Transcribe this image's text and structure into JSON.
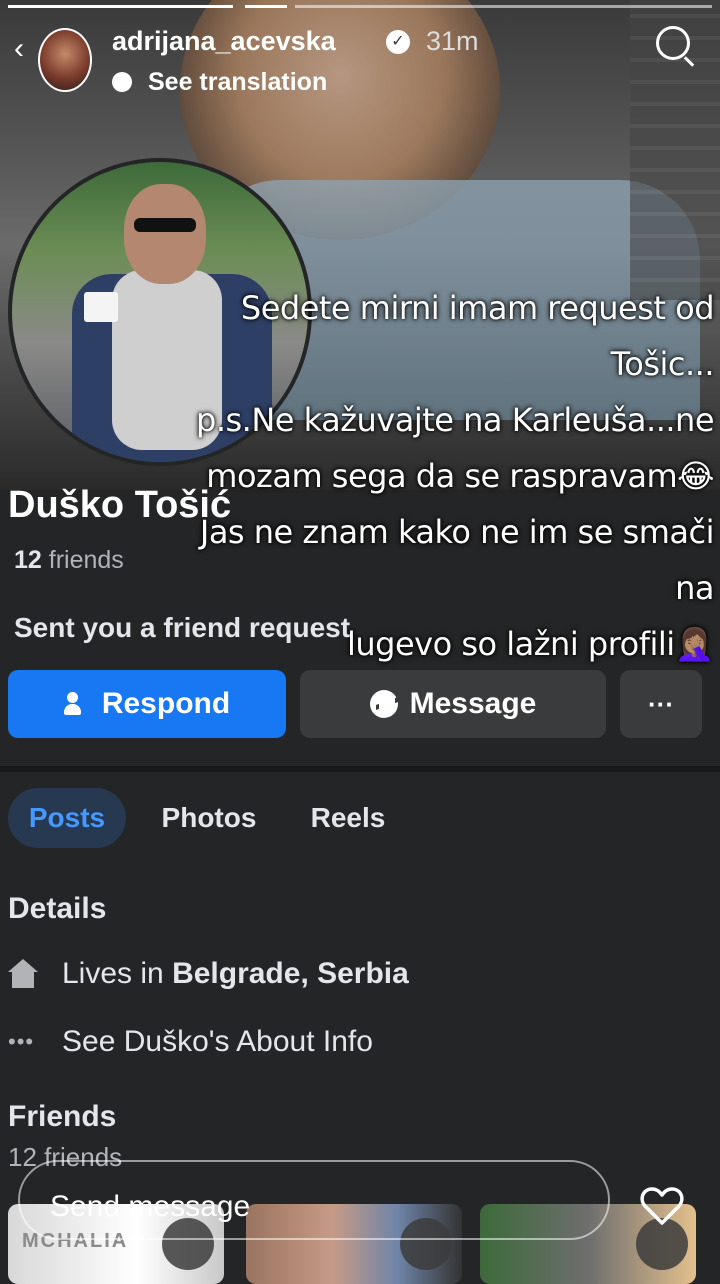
{
  "story": {
    "username": "adrijana_acevska",
    "time": "31m",
    "translation_label": "See translation",
    "caption_lines": [
      "Sedete mirni imam request od Tošic...",
      "p.s.Ne kažuvajte na Karleuša...ne",
      "mozam sega da se raspravam😂",
      "Jas ne znam kako ne im se smači na",
      "lugevo so lažni profili🤦🏽‍♀️"
    ],
    "send_placeholder": "Send message"
  },
  "profile": {
    "name": "Duško Tošić",
    "friends_count": "12",
    "friends_label": "friends",
    "request_text": "Sent you a friend request",
    "respond_label": "Respond",
    "message_label": "Message",
    "more_label": "···"
  },
  "tabs": [
    "Posts",
    "Photos",
    "Reels"
  ],
  "details": {
    "title": "Details",
    "lives_prefix": "Lives in",
    "lives_place": "Belgrade, Serbia",
    "about_label": "See Duško's About Info"
  },
  "friends": {
    "title": "Friends",
    "subtitle": "12 friends",
    "thumb1_text": "MCHALIA"
  },
  "colors": {
    "background": "#242526",
    "primary": "#1877f2",
    "tab_active_bg": "#263951",
    "tab_active_text": "#4599ff"
  }
}
